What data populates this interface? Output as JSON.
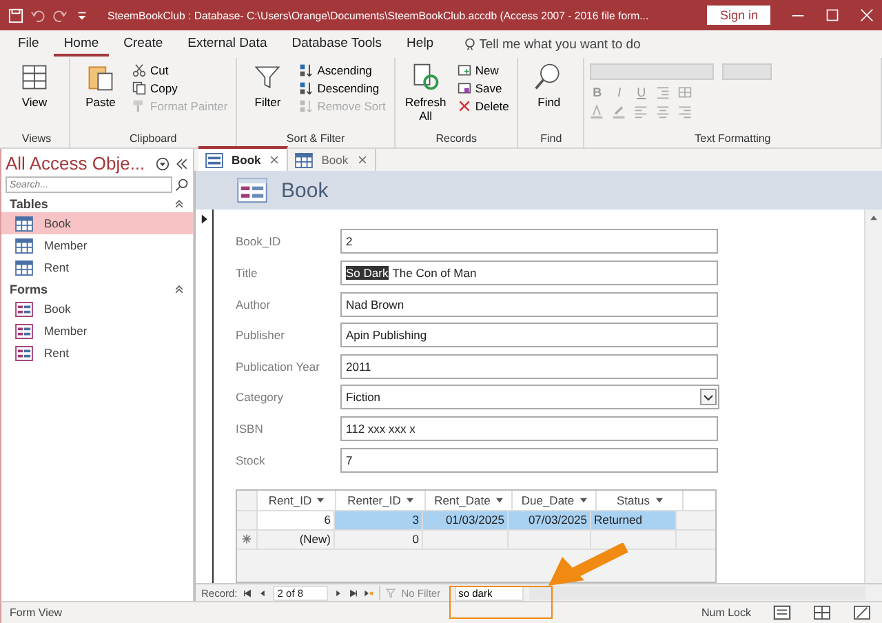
{
  "title_bar": {
    "title": "SteemBookClub : Database- C:\\Users\\Orange\\Documents\\SteemBookClub.accdb (Access 2007 - 2016 file form...",
    "sign_in": "Sign in"
  },
  "menu_tabs": [
    {
      "label": "File",
      "selected": false
    },
    {
      "label": "Home",
      "selected": true
    },
    {
      "label": "Create",
      "selected": false
    },
    {
      "label": "External Data",
      "selected": false
    },
    {
      "label": "Database Tools",
      "selected": false
    },
    {
      "label": "Help",
      "selected": false
    }
  ],
  "tell_me": {
    "placeholder": "Tell me what you want to do"
  },
  "ribbon": {
    "groups": [
      {
        "label": "Views",
        "buttons": [
          {
            "label": "View",
            "kind": "large",
            "disabled": false
          }
        ]
      },
      {
        "label": "Clipboard",
        "buttons": [
          {
            "label": "Paste",
            "kind": "large",
            "disabled": false
          },
          {
            "label": "Cut",
            "kind": "small",
            "disabled": false
          },
          {
            "label": "Copy",
            "kind": "small",
            "disabled": false
          },
          {
            "label": "Format Painter",
            "kind": "small",
            "disabled": true
          }
        ]
      },
      {
        "label": "Sort & Filter",
        "buttons": [
          {
            "label": "Filter",
            "kind": "large",
            "disabled": false
          },
          {
            "label": "Ascending",
            "kind": "small",
            "disabled": false
          },
          {
            "label": "Descending",
            "kind": "small",
            "disabled": false
          },
          {
            "label": "Remove Sort",
            "kind": "small",
            "disabled": true
          }
        ]
      },
      {
        "label": "Records",
        "buttons": [
          {
            "label": "Refresh All",
            "kind": "large",
            "disabled": false
          },
          {
            "label": "New",
            "kind": "small",
            "disabled": false
          },
          {
            "label": "Save",
            "kind": "small",
            "disabled": false
          },
          {
            "label": "Delete",
            "kind": "small",
            "disabled": false
          }
        ]
      },
      {
        "label": "Find",
        "buttons": [
          {
            "label": "Find",
            "kind": "large",
            "disabled": false
          }
        ]
      }
    ],
    "text_formatting": {
      "label": "Text Formatting",
      "buttons": [
        "B",
        "I",
        "U"
      ]
    }
  },
  "nav": {
    "title": "All Access Obje...",
    "search": {
      "placeholder": "Search..."
    },
    "sections": [
      {
        "label": "Tables",
        "kind": "table",
        "items": [
          {
            "label": "Book",
            "selected": true
          },
          {
            "label": "Member",
            "selected": false
          },
          {
            "label": "Rent",
            "selected": false
          }
        ]
      },
      {
        "label": "Forms",
        "kind": "form",
        "items": [
          {
            "label": "Book",
            "selected": false
          },
          {
            "label": "Member",
            "selected": false
          },
          {
            "label": "Rent",
            "selected": false
          }
        ]
      }
    ]
  },
  "doc_tabs": [
    {
      "label": "Book",
      "kind": "form",
      "selected": true
    },
    {
      "label": "Book",
      "kind": "table",
      "selected": false
    }
  ],
  "form": {
    "title": "Book",
    "fields": [
      {
        "label": "Book_ID",
        "kind": "text",
        "value": "2"
      },
      {
        "label": "Title",
        "kind": "text",
        "selected_text": "So Dark",
        "value": "The Con of Man"
      },
      {
        "label": "Author",
        "kind": "text",
        "value": "Nad Brown"
      },
      {
        "label": "Publisher",
        "kind": "text",
        "value": "Apin Publishing"
      },
      {
        "label": "Publication Year",
        "kind": "text",
        "value": "2011"
      },
      {
        "label": "Category",
        "kind": "combo",
        "value": "Fiction"
      },
      {
        "label": "ISBN",
        "kind": "text",
        "value": "112 xxx xxx x"
      },
      {
        "label": "Stock",
        "kind": "text",
        "value": "7"
      }
    ],
    "subform": {
      "columns": [
        "Rent_ID",
        "Renter_ID",
        "Rent_Date",
        "Due_Date",
        "Status"
      ],
      "rows": [
        {
          "kind": "current",
          "cells": [
            "6",
            "3",
            "01/03/2025",
            "07/03/2025",
            "Returned"
          ]
        },
        {
          "kind": "new",
          "cells": [
            "(New)",
            "0"
          ]
        }
      ]
    }
  },
  "record_nav": {
    "label": "Record:",
    "position": "2 of 8",
    "filter": "No Filter",
    "search": "so dark"
  },
  "status_bar": {
    "left": "Form View",
    "right": "Num Lock"
  }
}
